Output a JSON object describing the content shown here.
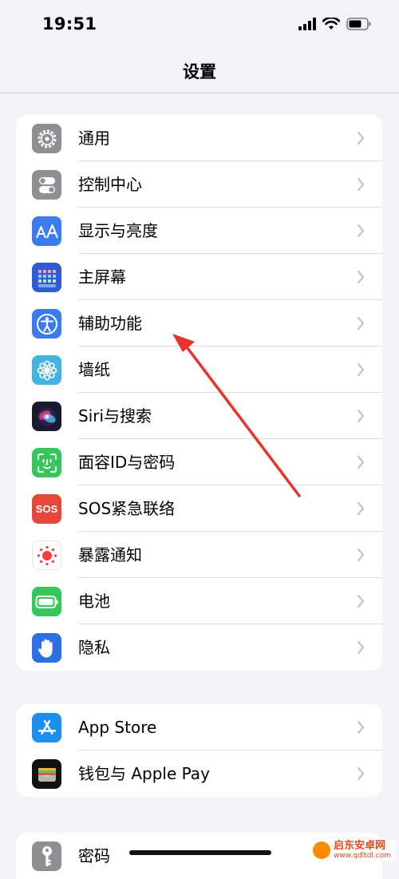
{
  "status_bar": {
    "time": "19:51"
  },
  "nav": {
    "title": "设置"
  },
  "groups": [
    {
      "items": [
        {
          "label": "通用",
          "icon": "gear-icon",
          "color": "#8e8e93"
        },
        {
          "label": "控制中心",
          "icon": "switches-icon",
          "color": "#8e8e93"
        },
        {
          "label": "显示与亮度",
          "icon": "text-size-icon",
          "color": "#3a7cf0"
        },
        {
          "label": "主屏幕",
          "icon": "home-grid-icon",
          "color": "#2f5bd6"
        },
        {
          "label": "辅助功能",
          "icon": "accessibility-icon",
          "color": "#3a7cf0"
        },
        {
          "label": "墙纸",
          "icon": "flower-icon",
          "color": "#45b3e0"
        },
        {
          "label": "Siri与搜索",
          "icon": "siri-icon",
          "color": "#1a1a2e"
        },
        {
          "label": "面容ID与密码",
          "icon": "face-id-icon",
          "color": "#34c759"
        },
        {
          "label": "SOS紧急联络",
          "icon": "sos-icon",
          "color": "#e5483b",
          "icon_text": "SOS"
        },
        {
          "label": "暴露通知",
          "icon": "exposure-icon",
          "color": "#ffffff"
        },
        {
          "label": "电池",
          "icon": "battery-icon",
          "color": "#34c759"
        },
        {
          "label": "隐私",
          "icon": "hand-icon",
          "color": "#2f6fe4"
        }
      ]
    },
    {
      "items": [
        {
          "label": "App Store",
          "icon": "app-store-icon",
          "color": "#1c8ef0"
        },
        {
          "label": "钱包与 Apple Pay",
          "icon": "wallet-icon",
          "color": "#111111"
        }
      ]
    },
    {
      "items": [
        {
          "label": "密码",
          "icon": "key-icon",
          "color": "#8e8e93"
        }
      ]
    }
  ],
  "annotation": {
    "icon": "red-arrow-icon",
    "color": "#e8322a"
  },
  "watermark": {
    "name": "启东安卓网",
    "url": "www.qdltdl.com"
  }
}
